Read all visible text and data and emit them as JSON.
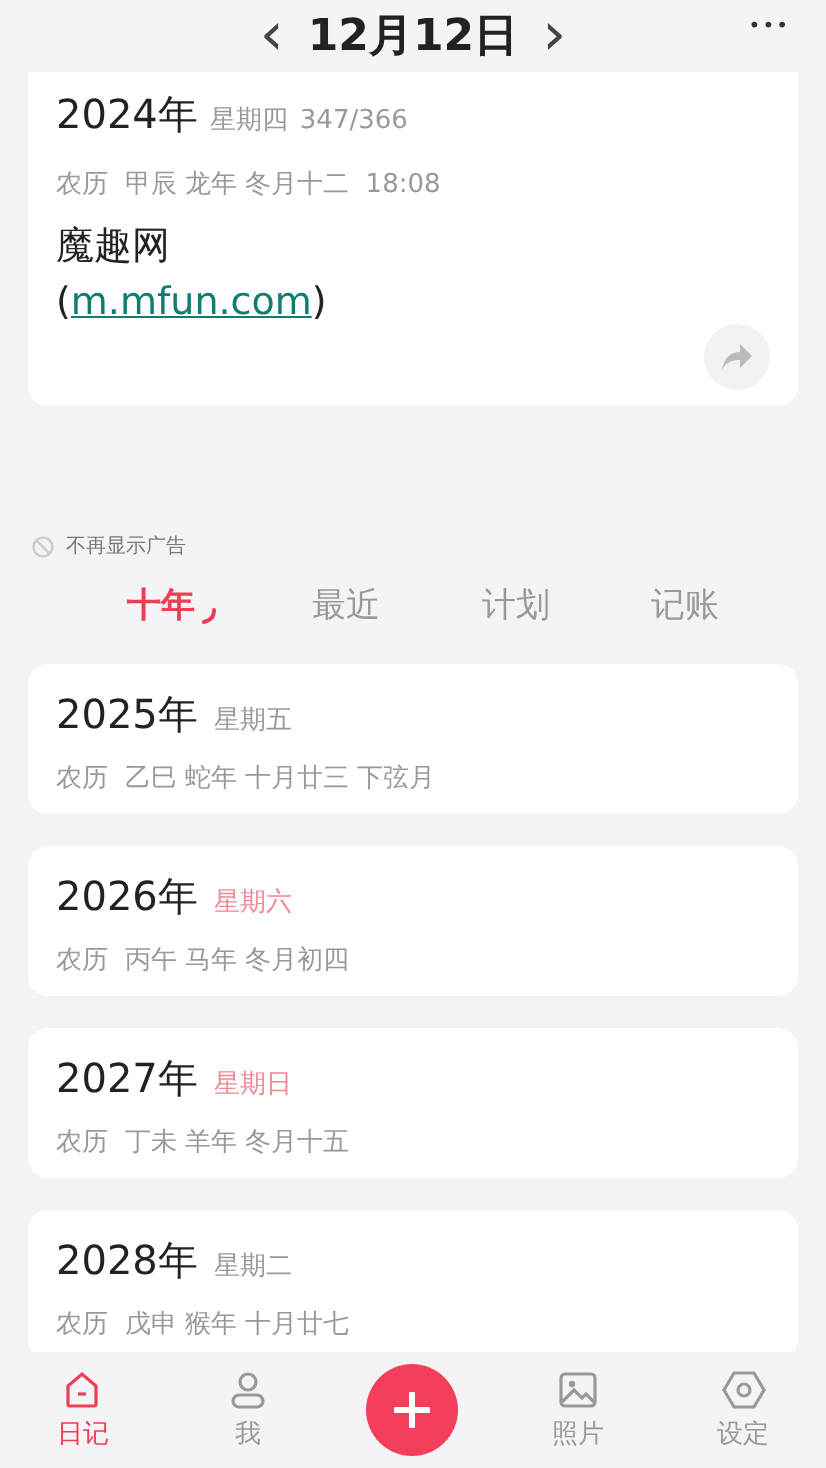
{
  "header": {
    "prev": "‹",
    "title": "12月12日",
    "next": "›",
    "more": "•••"
  },
  "today": {
    "year": "2024年",
    "weekday": "星期四",
    "day_count": "347/366",
    "lunar": "农历  甲辰 龙年 冬月十二  18:08",
    "site_name": "魔趣网",
    "open_paren": "(",
    "link": "m.mfun.com",
    "close_paren": ")"
  },
  "ad_notice": "不再显示广告",
  "tabs": [
    {
      "label": "十年",
      "selected": true
    },
    {
      "label": "最近",
      "selected": false
    },
    {
      "label": "计划",
      "selected": false
    },
    {
      "label": "记账",
      "selected": false
    }
  ],
  "years": [
    {
      "year": "2025年",
      "weekday": "星期五",
      "weekend": false,
      "lunar": "农历  乙巳 蛇年 十月廿三 下弦月"
    },
    {
      "year": "2026年",
      "weekday": "星期六",
      "weekend": true,
      "lunar": "农历  丙午 马年 冬月初四"
    },
    {
      "year": "2027年",
      "weekday": "星期日",
      "weekend": true,
      "lunar": "农历  丁未 羊年 冬月十五"
    },
    {
      "year": "2028年",
      "weekday": "星期二",
      "weekend": false,
      "lunar": "农历  戊申 猴年 十月廿七"
    }
  ],
  "nav": [
    {
      "kind": "home",
      "label": "日记",
      "selected": true
    },
    {
      "kind": "person",
      "label": "我",
      "selected": false
    },
    {
      "kind": "add"
    },
    {
      "kind": "photo",
      "label": "照片",
      "selected": false
    },
    {
      "kind": "settings",
      "label": "设定",
      "selected": false
    }
  ]
}
